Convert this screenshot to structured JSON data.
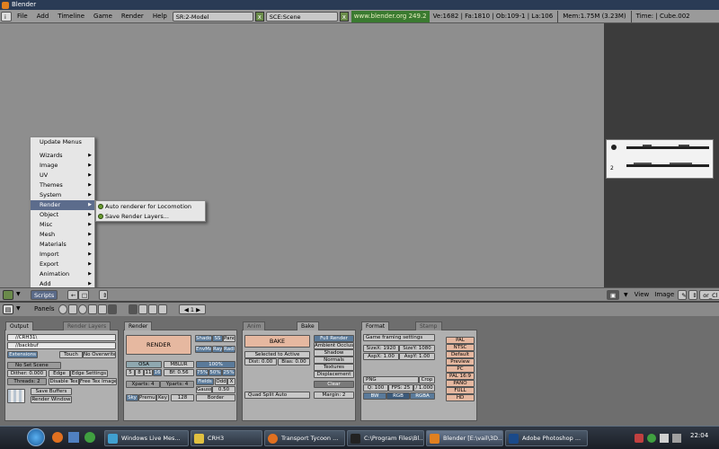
{
  "window": {
    "title": "Blender"
  },
  "menubar": {
    "items": [
      "File",
      "Add",
      "Timeline",
      "Game",
      "Render",
      "Help"
    ],
    "screen": "SR:2-Model",
    "scene": "SCE:Scene",
    "link": "www.blender.org 249.2",
    "stats": "Ve:1682 | Fa:1810 | Ob:109-1 | La:106",
    "mem": "Mem:1.75M (3.23M)",
    "time": "Time: | Cube.002"
  },
  "scripts_menu": {
    "items": [
      "Update Menus",
      "Wizards",
      "Image",
      "UV",
      "Themes",
      "System",
      "Render",
      "Object",
      "Misc",
      "Mesh",
      "Materials",
      "Import",
      "Export",
      "Animation",
      "Add"
    ],
    "submenu": [
      "Auto renderer for Locomotion",
      "Save Render Layers..."
    ],
    "scripts_label": "Scripts"
  },
  "image_header": {
    "view": "View",
    "image": "Image",
    "field": "or_Cl"
  },
  "buttons_header": {
    "panels": "Panels",
    "frame": "1"
  },
  "output_panel": {
    "tab": "Output",
    "tab2": "Render Layers",
    "path1": "//CRH31\\",
    "path2": "//backbuf",
    "extensions": "Extensions",
    "touch": "Touch",
    "no_overwrite": "No Overwrite",
    "no_set_scene": "No Set Scene",
    "dither": "Dither: 0.000",
    "edge": "Edge",
    "edge_settings": "Edge Settings",
    "threads": "Threads: 2",
    "disable_tex": "Disable Tex",
    "free_tex": "Free Tex Image",
    "save_buffers": "Save Buffers",
    "render_window": "Render Window"
  },
  "render_panel": {
    "tab": "Render",
    "render": "RENDER",
    "shado": "Shado",
    "ss": "SS",
    "pano": "Pano",
    "envma": "EnvMa",
    "ray": "Ray",
    "radi": "Radi",
    "osa": "OSA",
    "mblur": "MBLUR",
    "osa_levels": [
      "5",
      "8",
      "11",
      "16"
    ],
    "bf": "Bf: 0.56",
    "hundred": "100%",
    "pcts": [
      "75%",
      "50%",
      "25%"
    ],
    "xparts": "Xparts: 4",
    "yparts": "Yparts: 4",
    "fields": "Fields",
    "odd": "Odd",
    "x": "X",
    "gauss": "Gauss",
    "gauss_val": "0.50",
    "sky": "Sky",
    "premul": "Premul",
    "key": "Key",
    "k128": "128",
    "border": "Border"
  },
  "bake_panel": {
    "tab": "Anim",
    "tab2": "Bake",
    "bake": "BAKE",
    "options": [
      "Full Render",
      "Ambient Occlusion",
      "Shadow",
      "Normals",
      "Textures",
      "Displacement"
    ],
    "selected_to_active": "Selected to Active",
    "dist": "Dist: 0.00",
    "bias": "Bias: 0.00",
    "clear": "Clear",
    "quad_split": "Quad Split Auto",
    "margin": "Margin: 2"
  },
  "format_panel": {
    "tab": "Format",
    "tab2": "Stamp",
    "game_framing": "Game framing settings",
    "sizex": "SizeX: 1920",
    "sizey": "SizeY: 1080",
    "aspx": "AspX: 1.00",
    "aspy": "AspY: 1.00",
    "png": "PNG",
    "crop": "Crop",
    "q": "Q: 100",
    "fps": "FPS: 25",
    "fps2": "/ 1.000",
    "bw": "BW",
    "rgb": "RGB",
    "rgba": "RGBA",
    "presets": [
      "PAL",
      "NTSC",
      "Default",
      "Preview",
      "PC",
      "PAL 16:9",
      "PANO",
      "FULL",
      "HD"
    ]
  },
  "taskbar": {
    "tasks": [
      "Windows Live Mes...",
      "CRH3",
      "Transport Tycoon ...",
      "C:\\Program Files\\Bl...",
      "Blender [E:\\vail\\3D...",
      "Adobe Photoshop ..."
    ],
    "clock": "22:04"
  },
  "colors": {
    "accent": "#5c6c8c",
    "blender_green": "#3a7a30",
    "taskbar": "#1a1e26"
  }
}
